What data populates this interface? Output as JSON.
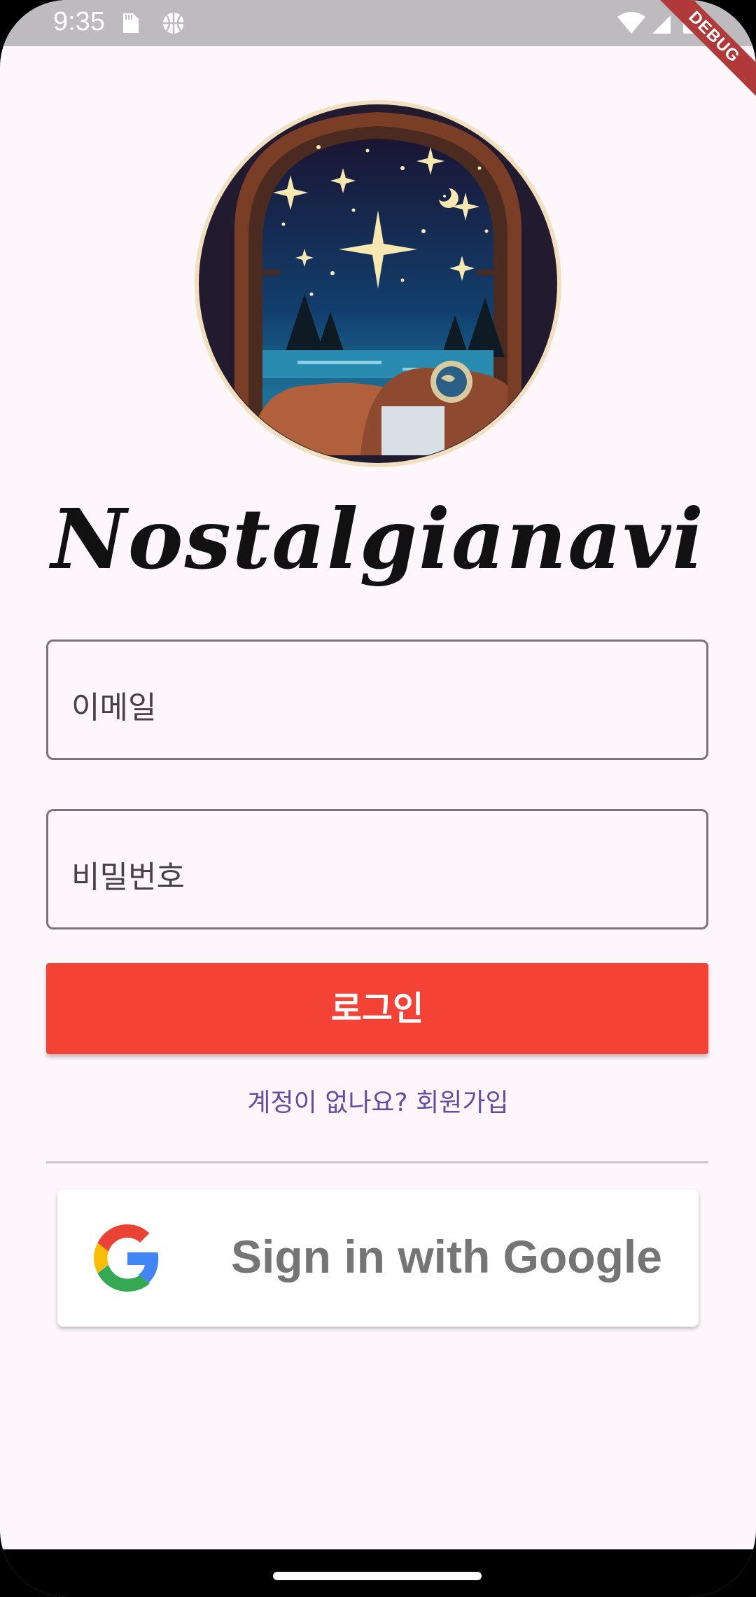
{
  "status_bar": {
    "time": "9:35",
    "debug_label": "DEBUG",
    "icons_left": [
      "sd-card-icon",
      "basketball-icon"
    ],
    "icons_right": [
      "wifi-icon",
      "signal-icon",
      "battery-icon"
    ]
  },
  "app": {
    "name": "Nostalgianavi",
    "logo": "night-sky-window-logo"
  },
  "login_form": {
    "email_placeholder": "이메일",
    "password_placeholder": "비밀번호",
    "login_button_label": "로그인",
    "signup_link_label": "계정이 없나요? 회원가입"
  },
  "google_signin": {
    "label": "Sign in with Google",
    "icon": "google-g-icon"
  },
  "colors": {
    "primary_button": "#f44336",
    "link": "#5f4ea5",
    "background": "#fdf7fb"
  }
}
